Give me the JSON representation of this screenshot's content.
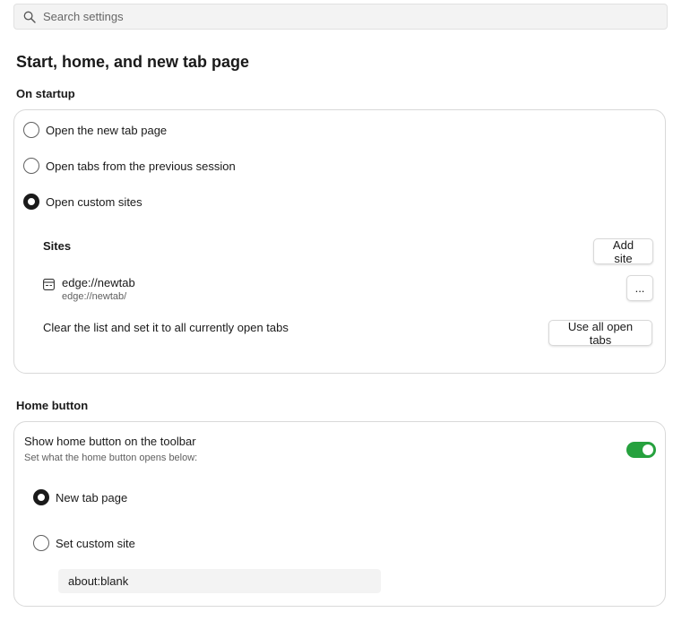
{
  "search": {
    "placeholder": "Search settings"
  },
  "page_title": "Start, home, and new tab page",
  "on_startup": {
    "heading": "On startup",
    "options": [
      {
        "label": "Open the new tab page",
        "checked": false
      },
      {
        "label": "Open tabs from the previous session",
        "checked": false
      },
      {
        "label": "Open custom sites",
        "checked": true
      }
    ],
    "sites_heading": "Sites",
    "add_site_label": "Add site",
    "sites": [
      {
        "title": "edge://newtab",
        "url": "edge://newtab/",
        "more_label": "..."
      }
    ],
    "clear_text": "Clear the list and set it to all currently open tabs",
    "use_all_label": "Use all open tabs"
  },
  "home_button": {
    "heading": "Home button",
    "show_label": "Show home button on the toolbar",
    "show_sublabel": "Set what the home button opens below:",
    "toggle_on": true,
    "options": [
      {
        "label": "New tab page",
        "checked": true
      },
      {
        "label": "Set custom site",
        "checked": false
      }
    ],
    "custom_site_value": "about:blank"
  },
  "colors": {
    "toggle_on": "#26a13e",
    "radio_checked": "#1a1a1a"
  }
}
